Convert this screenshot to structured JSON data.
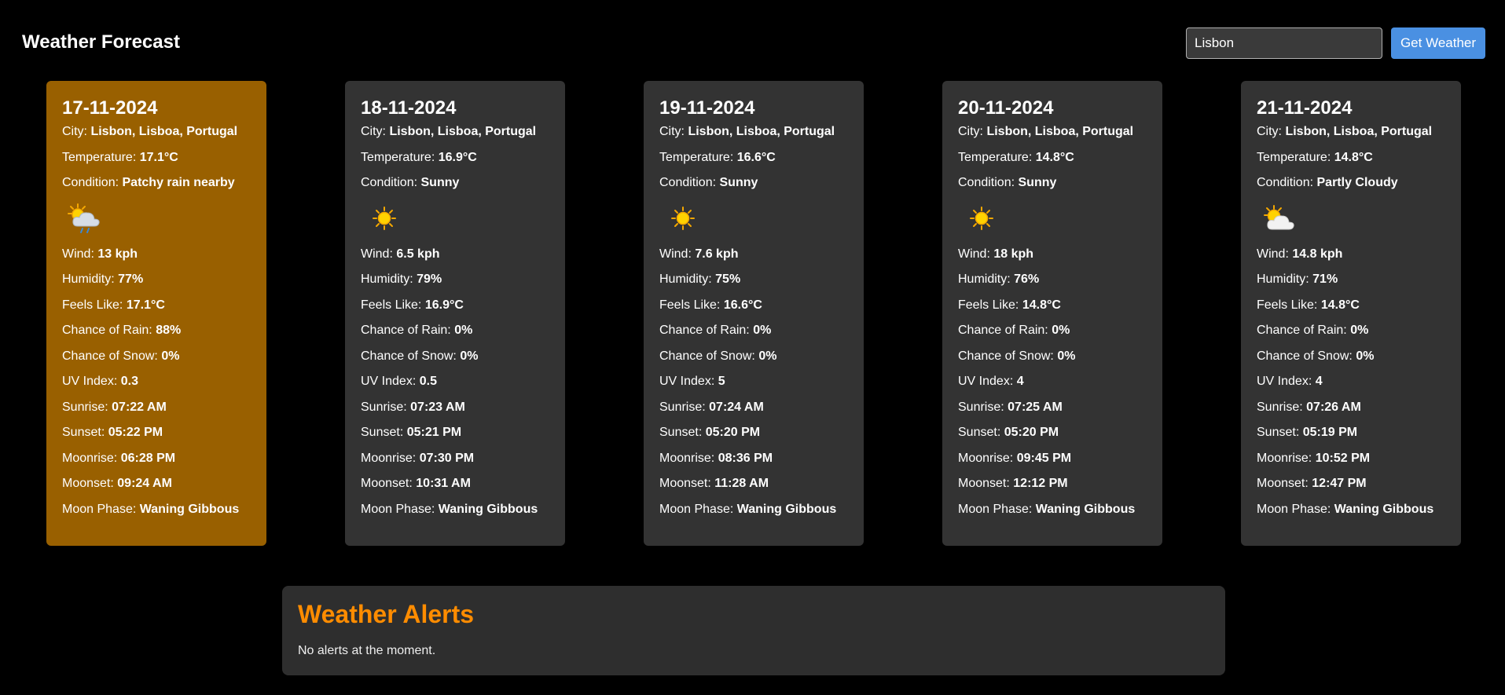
{
  "app": {
    "title": "Weather Forecast"
  },
  "search": {
    "value": "Lisbon",
    "button_label": "Get Weather"
  },
  "labels": {
    "city": "City:",
    "temperature": "Temperature:",
    "condition": "Condition:",
    "wind": "Wind:",
    "humidity": "Humidity:",
    "feels_like": "Feels Like:",
    "chance_rain": "Chance of Rain:",
    "chance_snow": "Chance of Snow:",
    "uv": "UV Index:",
    "sunrise": "Sunrise:",
    "sunset": "Sunset:",
    "moonrise": "Moonrise:",
    "moonset": "Moonset:",
    "moon_phase": "Moon Phase:"
  },
  "colors": {
    "active_card": "#996000",
    "card": "#333333",
    "accent_button": "#4a90e2",
    "alerts_title": "#ff8c00"
  },
  "forecast": [
    {
      "date": "17-11-2024",
      "city": "Lisbon, Lisboa, Portugal",
      "temperature": "17.1°C",
      "condition": "Patchy rain nearby",
      "icon": "patchy-rain-icon",
      "wind": "13 kph",
      "humidity": "77%",
      "feels_like": "17.1°C",
      "chance_rain": "88%",
      "chance_snow": "0%",
      "uv": "0.3",
      "sunrise": "07:22 AM",
      "sunset": "05:22 PM",
      "moonrise": "06:28 PM",
      "moonset": "09:24 AM",
      "moon_phase": "Waning Gibbous"
    },
    {
      "date": "18-11-2024",
      "city": "Lisbon, Lisboa, Portugal",
      "temperature": "16.9°C",
      "condition": "Sunny",
      "icon": "sun-icon",
      "wind": "6.5 kph",
      "humidity": "79%",
      "feels_like": "16.9°C",
      "chance_rain": "0%",
      "chance_snow": "0%",
      "uv": "0.5",
      "sunrise": "07:23 AM",
      "sunset": "05:21 PM",
      "moonrise": "07:30 PM",
      "moonset": "10:31 AM",
      "moon_phase": "Waning Gibbous"
    },
    {
      "date": "19-11-2024",
      "city": "Lisbon, Lisboa, Portugal",
      "temperature": "16.6°C",
      "condition": "Sunny",
      "icon": "sun-icon",
      "wind": "7.6 kph",
      "humidity": "75%",
      "feels_like": "16.6°C",
      "chance_rain": "0%",
      "chance_snow": "0%",
      "uv": "5",
      "sunrise": "07:24 AM",
      "sunset": "05:20 PM",
      "moonrise": "08:36 PM",
      "moonset": "11:28 AM",
      "moon_phase": "Waning Gibbous"
    },
    {
      "date": "20-11-2024",
      "city": "Lisbon, Lisboa, Portugal",
      "temperature": "14.8°C",
      "condition": "Sunny",
      "icon": "sun-icon",
      "wind": "18 kph",
      "humidity": "76%",
      "feels_like": "14.8°C",
      "chance_rain": "0%",
      "chance_snow": "0%",
      "uv": "4",
      "sunrise": "07:25 AM",
      "sunset": "05:20 PM",
      "moonrise": "09:45 PM",
      "moonset": "12:12 PM",
      "moon_phase": "Waning Gibbous"
    },
    {
      "date": "21-11-2024",
      "city": "Lisbon, Lisboa, Portugal",
      "temperature": "14.8°C",
      "condition": "Partly Cloudy",
      "icon": "partly-cloudy-icon",
      "wind": "14.8 kph",
      "humidity": "71%",
      "feels_like": "14.8°C",
      "chance_rain": "0%",
      "chance_snow": "0%",
      "uv": "4",
      "sunrise": "07:26 AM",
      "sunset": "05:19 PM",
      "moonrise": "10:52 PM",
      "moonset": "12:47 PM",
      "moon_phase": "Waning Gibbous"
    }
  ],
  "alerts": {
    "title": "Weather Alerts",
    "message": "No alerts at the moment."
  }
}
